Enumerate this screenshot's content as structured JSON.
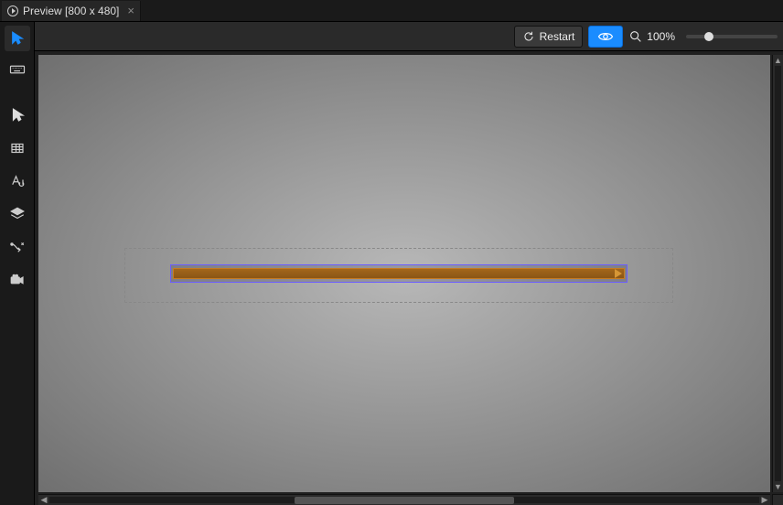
{
  "tab": {
    "title": "Preview [800 x 480]"
  },
  "toolbar": {
    "restart_label": "Restart",
    "zoom_value": "100%"
  },
  "tools": [
    {
      "name": "direct-select-icon"
    },
    {
      "name": "pointer-icon"
    },
    {
      "name": "grid-icon"
    },
    {
      "name": "text-style-icon"
    },
    {
      "name": "layers-icon"
    },
    {
      "name": "connector-icon"
    },
    {
      "name": "camera-icon"
    }
  ],
  "canvas": {
    "artboard_w": 800,
    "artboard_h": 480
  },
  "colors": {
    "accent": "#1a8cff",
    "select": "#6a5cff",
    "timeline": "#c77a1f"
  }
}
